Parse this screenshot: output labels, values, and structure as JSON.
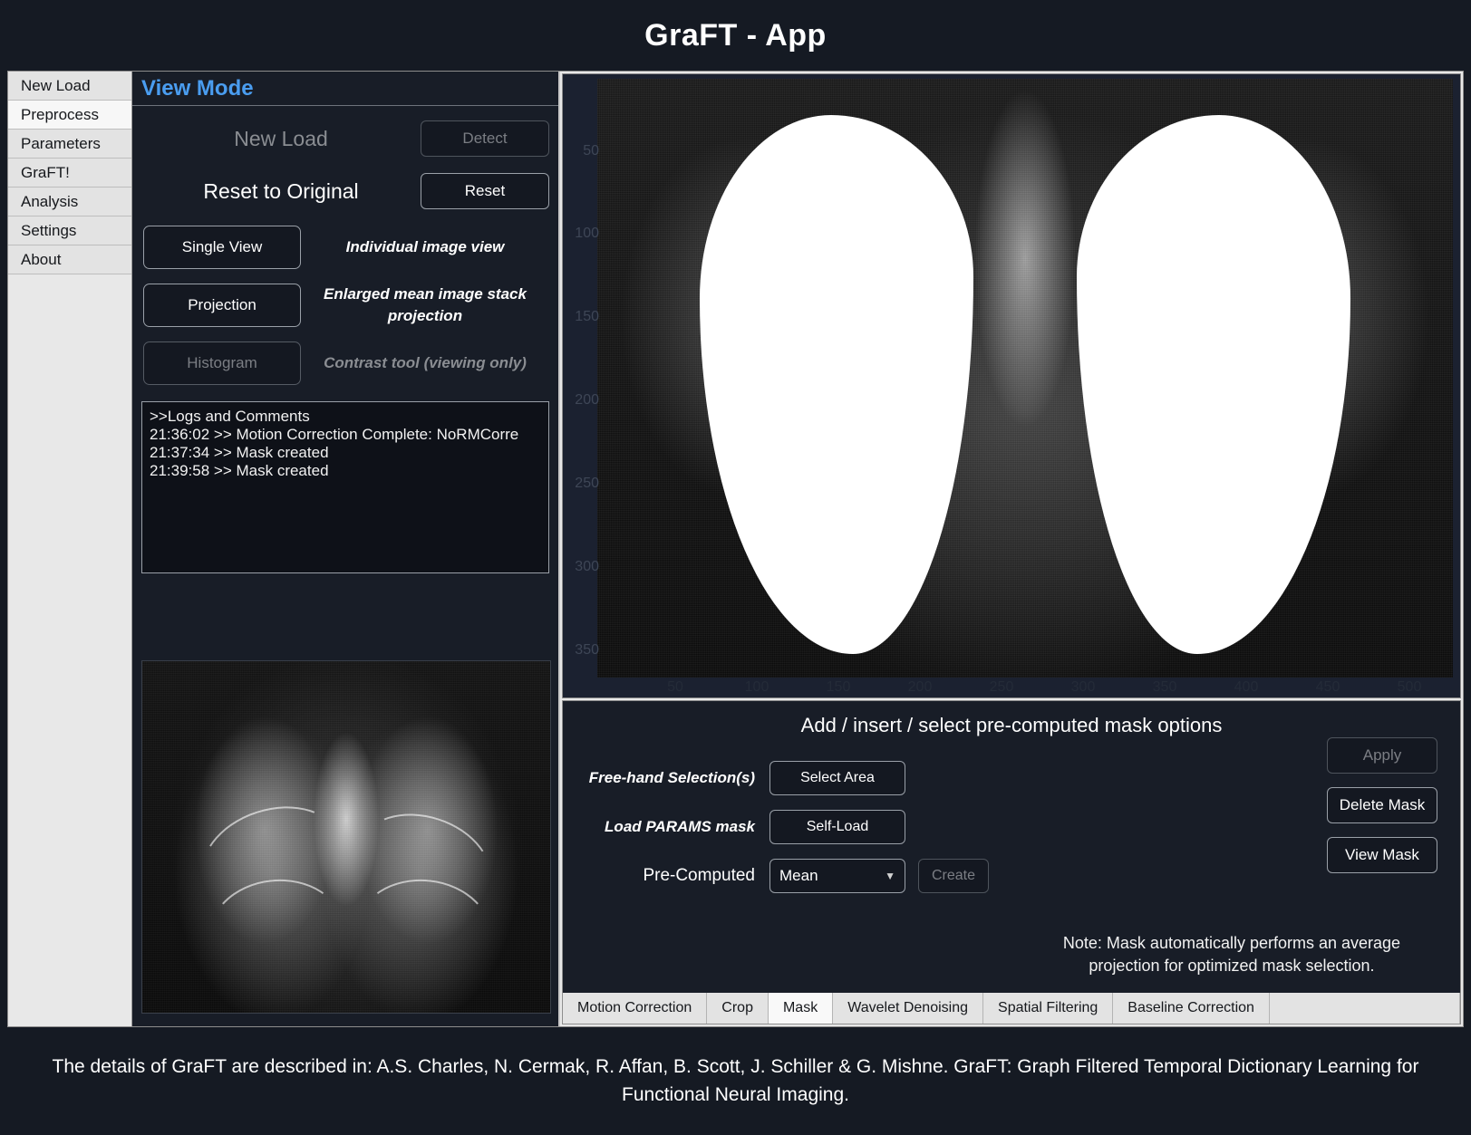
{
  "app": {
    "title": "GraFT - App"
  },
  "sidebar": {
    "items": [
      {
        "label": "New Load",
        "active": false
      },
      {
        "label": "Preprocess",
        "active": true
      },
      {
        "label": "Parameters",
        "active": false
      },
      {
        "label": "GraFT!",
        "active": false
      },
      {
        "label": "Analysis",
        "active": false
      },
      {
        "label": "Settings",
        "active": false
      },
      {
        "label": "About",
        "active": false
      }
    ]
  },
  "view_mode": {
    "header": "View Mode",
    "new_load_label": "New Load",
    "detect_button": "Detect",
    "reset_label": "Reset to Original",
    "reset_button": "Reset",
    "modes": [
      {
        "button": "Single View",
        "desc": "Individual image view"
      },
      {
        "button": "Projection",
        "desc": "Enlarged mean image stack projection"
      },
      {
        "button": "Histogram",
        "desc": "Contrast tool (viewing only)"
      }
    ],
    "logs": [
      ">>Logs and Comments",
      "21:36:02 >> Motion Correction Complete: NoRMCorre",
      "21:37:34 >> Mask created",
      "21:39:58 >> Mask created"
    ]
  },
  "plot": {
    "yticks": [
      "50",
      "100",
      "150",
      "200",
      "250",
      "300",
      "350"
    ],
    "xticks": [
      "50",
      "100",
      "150",
      "200",
      "250",
      "300",
      "350",
      "400",
      "450",
      "500"
    ]
  },
  "mask_panel": {
    "title": "Add / insert / select pre-computed mask options",
    "rows": [
      {
        "label": "Free-hand Selection(s)",
        "button": "Select Area"
      },
      {
        "label": "Load PARAMS mask",
        "button": "Self-Load"
      }
    ],
    "precomputed_label": "Pre-Computed",
    "precomputed_value": "Mean",
    "precomputed_options": [
      "Mean"
    ],
    "create_button": "Create",
    "actions": [
      {
        "label": "Apply",
        "enabled": false
      },
      {
        "label": "Delete Mask",
        "enabled": true
      },
      {
        "label": "View Mask",
        "enabled": true
      }
    ],
    "note": "Note: Mask automatically performs an average projection for optimized mask selection."
  },
  "tabs": [
    {
      "label": "Motion Correction",
      "active": false
    },
    {
      "label": "Crop",
      "active": false
    },
    {
      "label": "Mask",
      "active": true
    },
    {
      "label": "Wavelet Denoising",
      "active": false
    },
    {
      "label": "Spatial Filtering",
      "active": false
    },
    {
      "label": "Baseline Correction",
      "active": false
    }
  ],
  "footer": {
    "text": "The details of GraFT are described in: A.S. Charles, N. Cermak, R. Affan, B. Scott, J. Schiller & G. Mishne. GraFT: Graph Filtered Temporal Dictionary Learning for Functional Neural Imaging."
  },
  "colors": {
    "accent": "#4a9df0",
    "panel_bg": "#181d27",
    "window_bg": "#151a23",
    "chrome": "#e8e8e8"
  }
}
